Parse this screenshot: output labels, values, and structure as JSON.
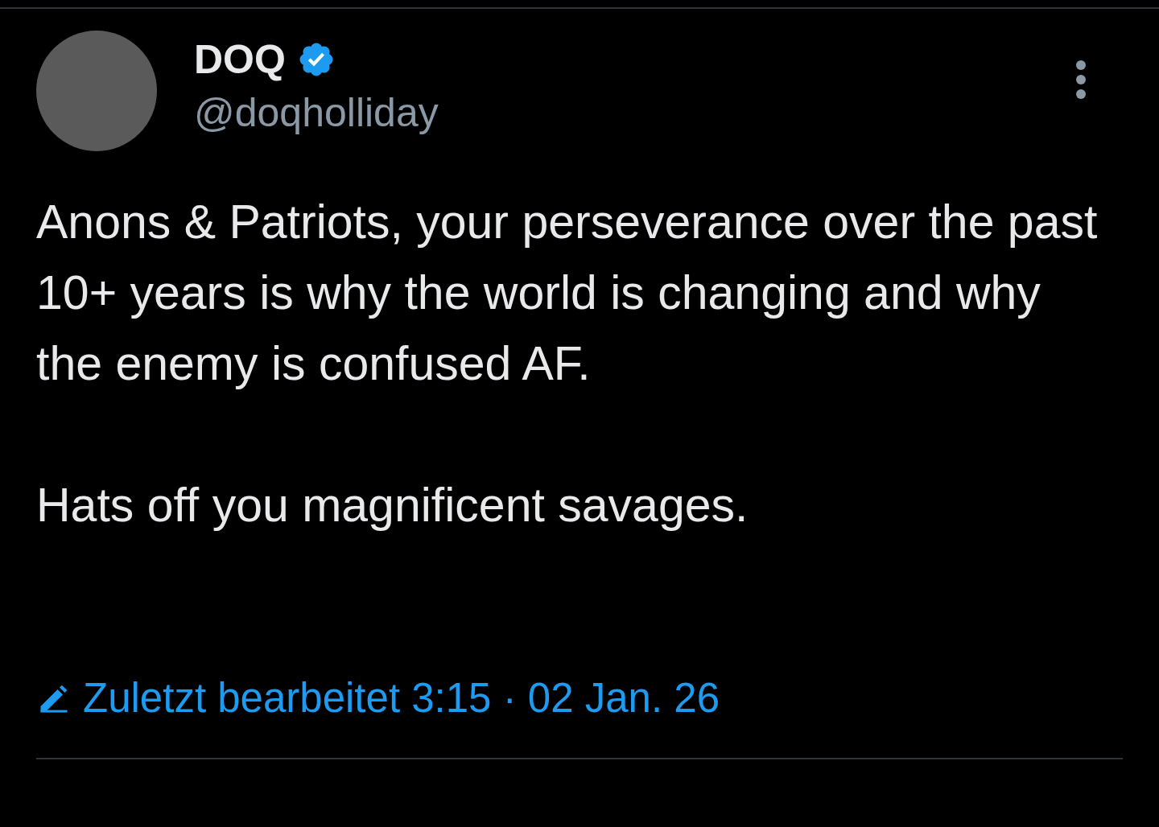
{
  "post": {
    "author": {
      "name": "DOQ",
      "verified": true,
      "handle": "@doqholliday"
    },
    "paragraphs": [
      "Anons & Patriots, your perseverance over the past 10+ years is why the world is changing and why the enemy is confused AF.",
      "Hats off you magnificent savages."
    ],
    "edited": true,
    "footer": "Zuletzt bearbeitet 3:15 · 02 Jan. 26"
  }
}
